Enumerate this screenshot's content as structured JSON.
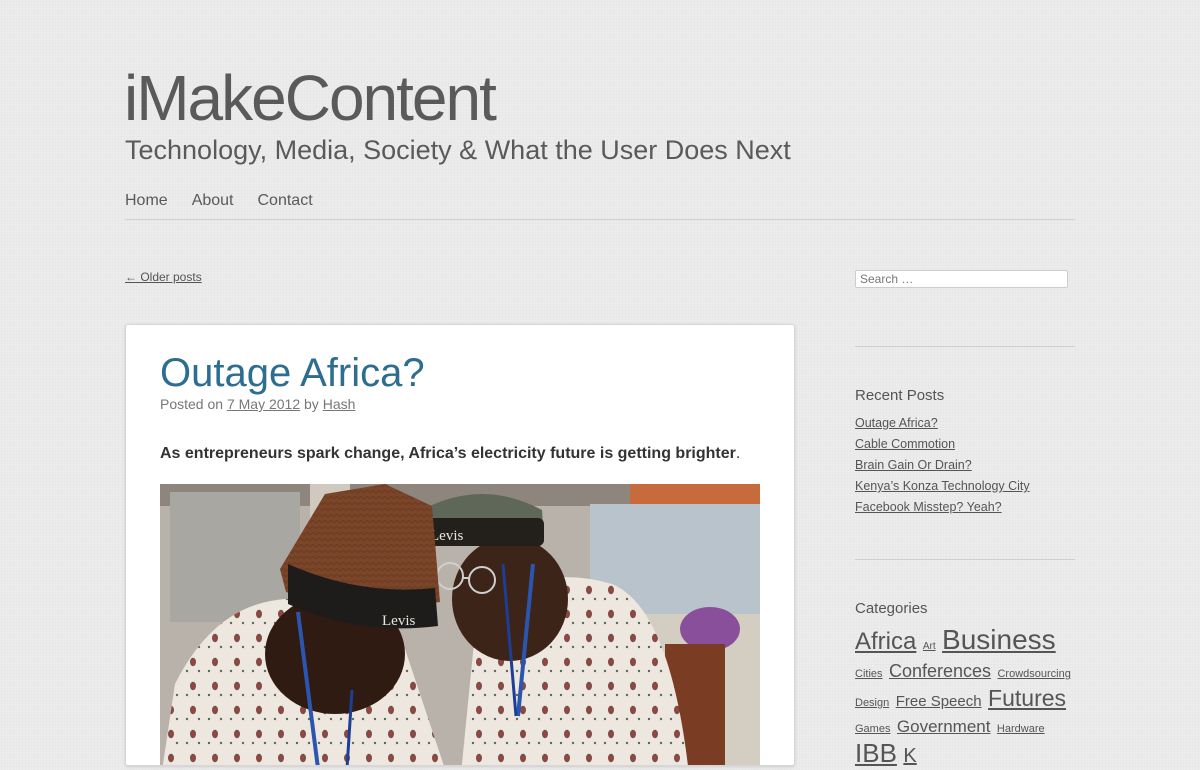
{
  "header": {
    "site_title": "iMakeContent",
    "tagline": "Technology, Media, Society & What the User Does Next"
  },
  "nav": {
    "items": [
      "Home",
      "About",
      "Contact"
    ]
  },
  "pagination": {
    "older_posts": "← Older posts"
  },
  "post": {
    "title": "Outage Africa?",
    "meta_prefix": "Posted on",
    "date": "7 May 2012",
    "by": "by",
    "author": "Hash",
    "lede": "As entrepreneurs spark change, Africa’s electricity future is getting brighter",
    "lede_end": ".",
    "photo": {
      "hat_text_1": "Levis",
      "hat_text_2": "Levis"
    }
  },
  "sidebar": {
    "search_placeholder": "Search …",
    "recent_posts": {
      "title": "Recent Posts",
      "items": [
        "Outage Africa?",
        "Cable Commotion",
        "Brain Gain Or Drain?",
        "Kenya’s Konza Technology City",
        "Facebook Misstep? Yeah?"
      ]
    },
    "categories": {
      "title": "Categories",
      "tags": [
        "Africa",
        "Art",
        "Business",
        "Cities",
        "Conferences",
        "Crowdsourcing",
        "Design",
        "Free Speech",
        "Futures",
        "Games",
        "Government",
        "Hardware",
        "IBB",
        "K"
      ]
    }
  },
  "colors": {
    "background": "#ececec",
    "post_title": "#2c6d90",
    "text": "#555555"
  }
}
